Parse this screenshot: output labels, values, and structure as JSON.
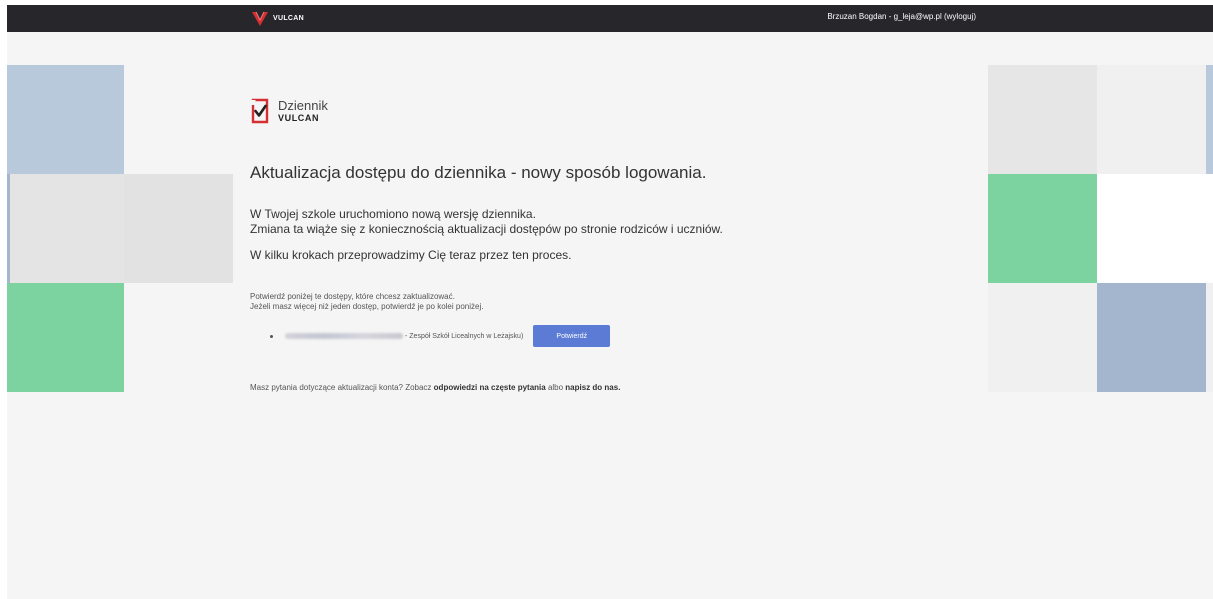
{
  "topbar": {
    "brand": "VULCAN",
    "user": "Brzuzan Bogdan - g_leja@wp.pl",
    "logout": "(wyloguj)"
  },
  "brand_block": {
    "line1": "Dziennik",
    "line2": "VULCAN"
  },
  "heading": "Aktualizacja dostępu do dziennika - nowy sposób logowania.",
  "lead": {
    "line1": "W Twojej szkole uruchomiono nową wersję dziennika.",
    "line2": "Zmiana ta wiąże się z koniecznością aktualizacji dostępów po stronie rodziców i uczniów.",
    "line3": "W kilku krokach przeprowadzimy Cię teraz przez ten proces."
  },
  "instructions": {
    "line1": "Potwierdź poniżej te dostępy, które chcesz zaktualizować.",
    "line2": "Jeżeli masz więcej niż jeden dostęp, potwierdź je po kolei poniżej."
  },
  "access": {
    "school": "- Zespół Szkół Licealnych w Leżajsku)",
    "confirm_label": "Potwierdź"
  },
  "faq": {
    "prefix": "Masz pytania dotyczące aktualizacji konta? Zobacz",
    "link1": "odpowiedzi na częste pytania",
    "middle": "albo",
    "link2": "napisz do nas."
  },
  "colors": {
    "topbar": "#26262b",
    "accent_button": "#5b7bd5",
    "brand_red": "#d62f33",
    "tile_blue": "#b8c9dc",
    "tile_blue_dark": "#a3b6cd",
    "tile_gray": "#e6e6e6",
    "tile_green": "#7dd3a0"
  },
  "icons": [
    "vulcan-logo-icon",
    "checkbox-check-icon"
  ]
}
